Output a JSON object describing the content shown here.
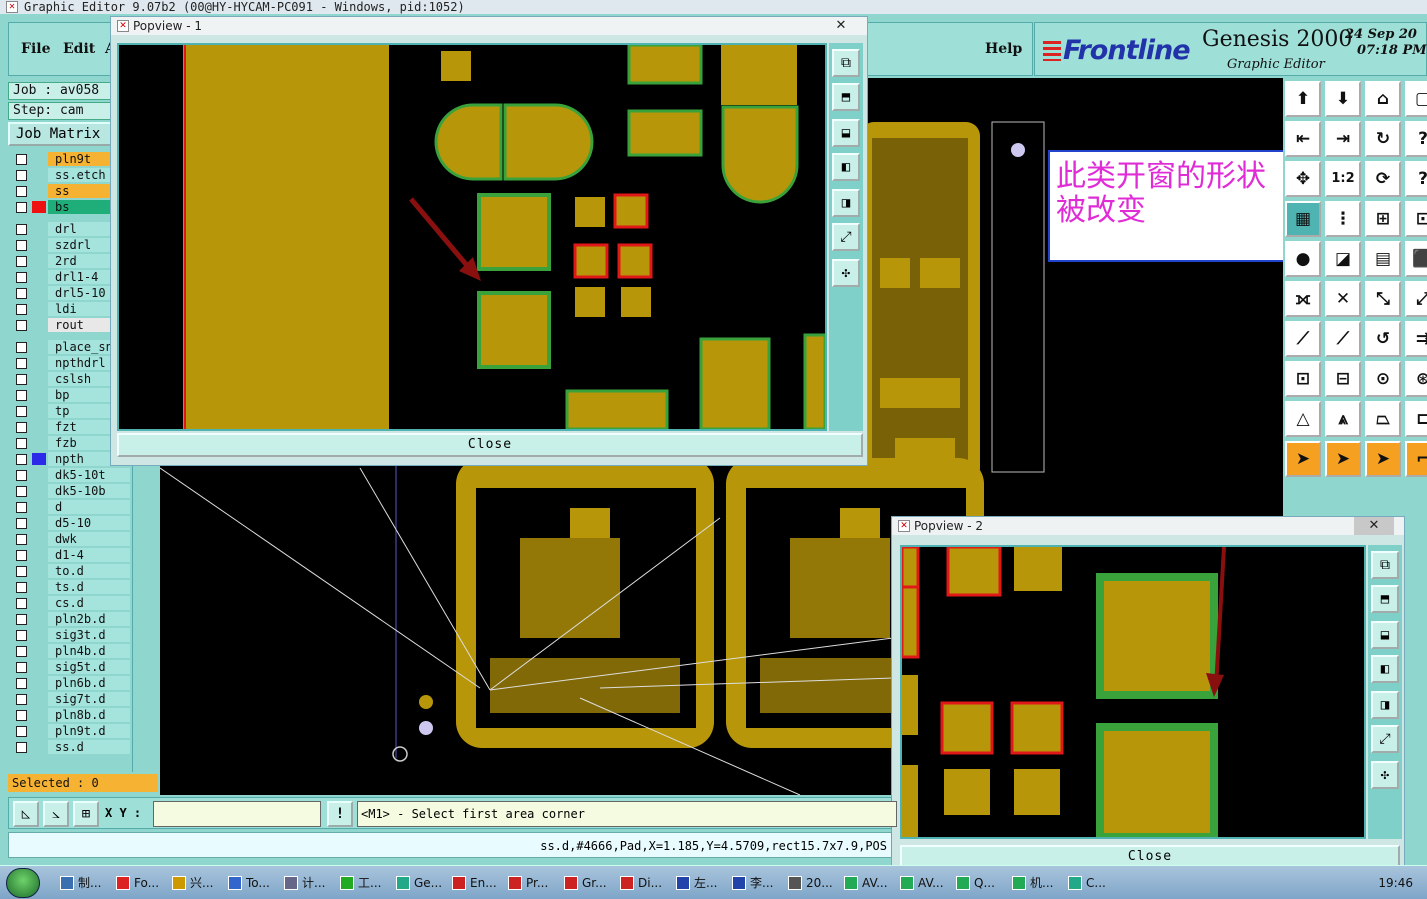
{
  "window": {
    "title": "Graphic Editor 9.07b2 (00@HY-HYCAM-PC091 - Windows, pid:1052)"
  },
  "menu": {
    "file": "File",
    "edit": "Edit",
    "partial": "A",
    "help": "Help"
  },
  "brand": {
    "logo": "Frontline",
    "product": "Genesis 2000",
    "subtitle": "Graphic Editor",
    "date": "24 Sep 20",
    "time": "07:18 PM"
  },
  "job": {
    "job_label": "Job : av058",
    "step_label": "Step: cam",
    "matrix_button": "Job Matrix"
  },
  "layers": [
    {
      "name": "pln9t",
      "color": "#f6b233",
      "swatch": ""
    },
    {
      "name": "ss.etch",
      "color": "#a5e4dd",
      "swatch": ""
    },
    {
      "name": "ss",
      "color": "#f6b233",
      "swatch": ""
    },
    {
      "name": "bs",
      "color": "#1fae7a",
      "swatch": "#e11"
    },
    {
      "name": "drl",
      "color": "#a5e4dd",
      "swatch": ""
    },
    {
      "name": "szdrl",
      "color": "#a5e4dd",
      "swatch": ""
    },
    {
      "name": "2rd",
      "color": "#a5e4dd",
      "swatch": ""
    },
    {
      "name": "drl1-4",
      "color": "#a5e4dd",
      "swatch": ""
    },
    {
      "name": "drl5-10",
      "color": "#a5e4dd",
      "swatch": ""
    },
    {
      "name": "ldi",
      "color": "#a5e4dd",
      "swatch": ""
    },
    {
      "name": "rout",
      "color": "#e8e8e8",
      "swatch": ""
    },
    {
      "name": "place_sn",
      "color": "#a5e4dd",
      "swatch": ""
    },
    {
      "name": "npthdrl",
      "color": "#a5e4dd",
      "swatch": ""
    },
    {
      "name": "cslsh",
      "color": "#a5e4dd",
      "swatch": ""
    },
    {
      "name": "bp",
      "color": "#a5e4dd",
      "swatch": ""
    },
    {
      "name": "tp",
      "color": "#a5e4dd",
      "swatch": ""
    },
    {
      "name": "fzt",
      "color": "#a5e4dd",
      "swatch": ""
    },
    {
      "name": "fzb",
      "color": "#a5e4dd",
      "swatch": ""
    },
    {
      "name": "npth",
      "color": "#a5e4dd",
      "swatch": "#2a2ae8"
    },
    {
      "name": "dk5-10t",
      "color": "#a5e4dd",
      "swatch": ""
    },
    {
      "name": "dk5-10b",
      "color": "#a5e4dd",
      "swatch": ""
    },
    {
      "name": "d",
      "color": "#a5e4dd",
      "swatch": ""
    },
    {
      "name": "d5-10",
      "color": "#a5e4dd",
      "swatch": ""
    },
    {
      "name": "dwk",
      "color": "#a5e4dd",
      "swatch": ""
    },
    {
      "name": "d1-4",
      "color": "#a5e4dd",
      "swatch": ""
    },
    {
      "name": "to.d",
      "color": "#a5e4dd",
      "swatch": ""
    },
    {
      "name": "ts.d",
      "color": "#a5e4dd",
      "swatch": ""
    },
    {
      "name": "cs.d",
      "color": "#a5e4dd",
      "swatch": ""
    },
    {
      "name": "pln2b.d",
      "color": "#a5e4dd",
      "swatch": ""
    },
    {
      "name": "sig3t.d",
      "color": "#a5e4dd",
      "swatch": ""
    },
    {
      "name": "pln4b.d",
      "color": "#a5e4dd",
      "swatch": ""
    },
    {
      "name": "sig5t.d",
      "color": "#a5e4dd",
      "swatch": ""
    },
    {
      "name": "pln6b.d",
      "color": "#a5e4dd",
      "swatch": ""
    },
    {
      "name": "sig7t.d",
      "color": "#a5e4dd",
      "swatch": ""
    },
    {
      "name": "pln8b.d",
      "color": "#a5e4dd",
      "swatch": ""
    },
    {
      "name": "pln9t.d",
      "color": "#a5e4dd",
      "swatch": ""
    },
    {
      "name": "ss.d",
      "color": "#a5e4dd",
      "swatch": ""
    }
  ],
  "selection": {
    "selected_label": "Selected : 0"
  },
  "command": {
    "xy_label": "X Y :",
    "xy_value": "",
    "alert_label": "!",
    "prompt": "<M1> - Select first area corner"
  },
  "status": {
    "info": "ss.d,#4666,Pad,X=1.185,Y=4.5709,rect15.7x7.9,POS"
  },
  "popview1": {
    "title": "Popview - 1",
    "close_icon": "✕",
    "close_button": "Close"
  },
  "popview2": {
    "title": "Popview - 2",
    "close_icon": "✕",
    "close_button": "Close"
  },
  "annotation": {
    "line1": "此类开窗的形状",
    "line2": "被改变"
  },
  "taskbar": {
    "items": [
      "制...",
      "Fo...",
      "兴...",
      "To...",
      "计...",
      "工...",
      "Ge...",
      "En...",
      "Pr...",
      "Gr...",
      "Di...",
      "左...",
      "李...",
      "20...",
      "AV...",
      "AV...",
      "Q...",
      "机...",
      "C..."
    ],
    "clock": "19:46"
  },
  "colors": {
    "copper": "#b8960a",
    "mask_green": "#3aa23a",
    "highlight_red": "#e01818",
    "panel_teal": "#8fd6cf",
    "annotation_text": "#e02cd7"
  }
}
